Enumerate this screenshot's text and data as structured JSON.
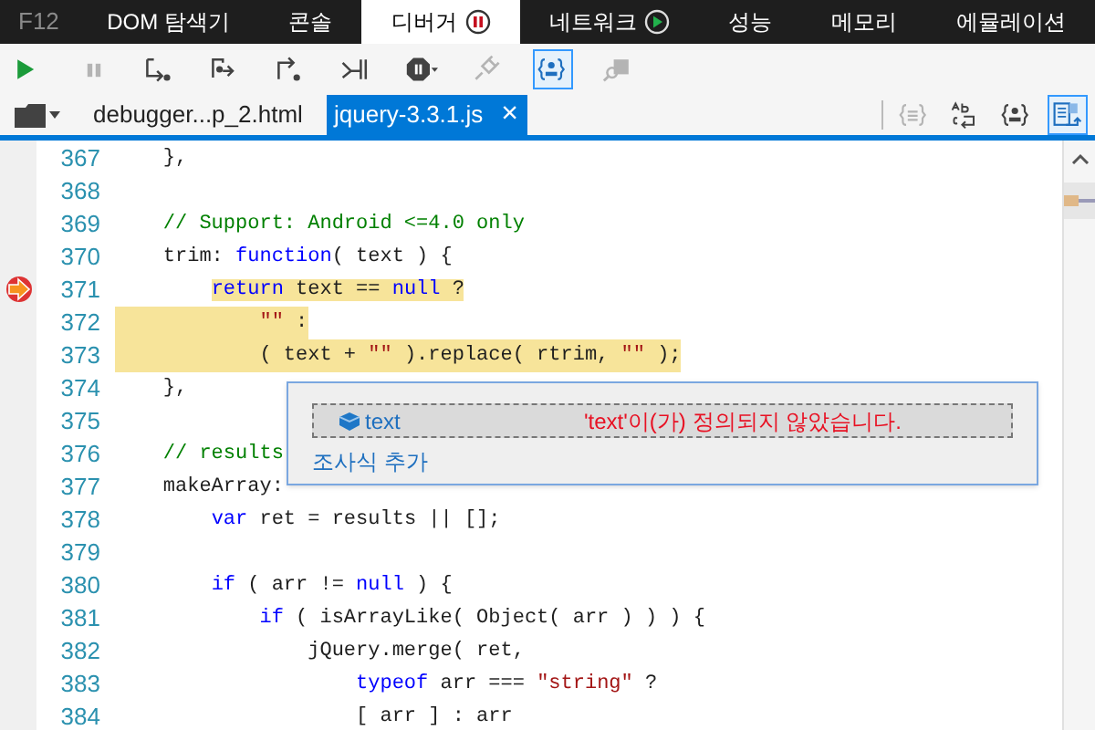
{
  "f12_label": "F12",
  "tabs": [
    {
      "label": "DOM 탐색기",
      "selected": false
    },
    {
      "label": "콘솔",
      "selected": false
    },
    {
      "label": "디버거",
      "selected": true,
      "kind": "paused"
    },
    {
      "label": "네트워크",
      "selected": false,
      "kind": "recording"
    },
    {
      "label": "성능",
      "selected": false
    },
    {
      "label": "메모리",
      "selected": false
    },
    {
      "label": "에뮬레이션",
      "selected": false
    }
  ],
  "toolbar": [
    {
      "kind": "continue",
      "disabled": false,
      "selected": false
    },
    {
      "kind": "pause",
      "disabled": true,
      "selected": false
    },
    {
      "kind": "step-into",
      "disabled": false,
      "selected": false
    },
    {
      "kind": "step-over",
      "disabled": false,
      "selected": false
    },
    {
      "kind": "step-out",
      "disabled": false,
      "selected": false
    },
    {
      "kind": "break-new-worker",
      "disabled": false,
      "selected": false
    },
    {
      "kind": "exception",
      "disabled": false,
      "selected": false
    },
    {
      "kind": "disconnect",
      "disabled": true,
      "selected": false
    },
    {
      "kind": "just-my-code",
      "disabled": false,
      "selected": true
    },
    {
      "kind": "find-source",
      "disabled": true,
      "selected": false
    }
  ],
  "file_tabs": [
    {
      "label": "debugger...p_2.html",
      "selected": false
    },
    {
      "label": "jquery-3.3.1.js",
      "selected": true,
      "close": "×"
    }
  ],
  "editor_tools": [
    {
      "kind": "pretty-print",
      "disabled": true,
      "selected": false
    },
    {
      "kind": "word-wrap",
      "disabled": false,
      "selected": false
    },
    {
      "kind": "just-my-code",
      "disabled": false,
      "selected": false
    },
    {
      "kind": "source-map",
      "disabled": false,
      "selected": true
    }
  ],
  "code_lines": [
    {
      "number": "367",
      "tokens": [
        {
          "kind": "p",
          "text": "    },"
        }
      ]
    },
    {
      "number": "368"
    },
    {
      "number": "369",
      "tokens": [
        {
          "kind": "c",
          "text": "    // Support: Android <=4.0 only"
        }
      ]
    },
    {
      "number": "370",
      "tokens": [
        {
          "kind": "p",
          "text": "    trim: "
        },
        {
          "kind": "k",
          "text": "function"
        },
        {
          "kind": "p",
          "text": "( text ) {"
        }
      ]
    },
    {
      "number": "371",
      "current": true,
      "highlighted": true,
      "tokens": [
        {
          "kind": "k",
          "text": "        return"
        },
        {
          "kind": "p",
          "text": " text == "
        },
        {
          "kind": "k",
          "text": "null"
        },
        {
          "kind": "p",
          "text": " ?"
        }
      ]
    },
    {
      "number": "372",
      "highlighted": true,
      "tokens": [
        {
          "kind": "s",
          "text": "            \"\""
        },
        {
          "kind": "p",
          "text": " :"
        }
      ]
    },
    {
      "number": "373",
      "highlighted": true,
      "tokens": [
        {
          "kind": "p",
          "text": "            ( text + "
        },
        {
          "kind": "s",
          "text": "\"\""
        },
        {
          "kind": "p",
          "text": " ).replace( rtrim, "
        },
        {
          "kind": "s",
          "text": "\"\""
        },
        {
          "kind": "p",
          "text": " );"
        }
      ]
    },
    {
      "number": "374",
      "tokens": [
        {
          "kind": "p",
          "text": "    },"
        }
      ]
    },
    {
      "number": "375"
    },
    {
      "number": "376",
      "tokens": [
        {
          "kind": "c",
          "text": "    // results"
        }
      ]
    },
    {
      "number": "377",
      "tokens": [
        {
          "kind": "p",
          "text": "    makeArray:"
        }
      ]
    },
    {
      "number": "378",
      "tokens": [
        {
          "kind": "k",
          "text": "        var"
        },
        {
          "kind": "p",
          "text": " ret = results || [];"
        }
      ]
    },
    {
      "number": "379"
    },
    {
      "number": "380",
      "tokens": [
        {
          "kind": "k",
          "text": "        if"
        },
        {
          "kind": "p",
          "text": " ( arr != "
        },
        {
          "kind": "k",
          "text": "null"
        },
        {
          "kind": "p",
          "text": " ) {"
        }
      ]
    },
    {
      "number": "381",
      "tokens": [
        {
          "kind": "k",
          "text": "            if"
        },
        {
          "kind": "p",
          "text": " ( isArrayLike( Object( arr ) ) ) {"
        }
      ]
    },
    {
      "number": "382",
      "tokens": [
        {
          "kind": "p",
          "text": "                jQuery.merge( ret,"
        }
      ]
    },
    {
      "number": "383",
      "tokens": [
        {
          "kind": "k",
          "text": "                    typeof"
        },
        {
          "kind": "p",
          "text": " arr === "
        },
        {
          "kind": "s",
          "text": "\"string\""
        },
        {
          "kind": "p",
          "text": " ?"
        }
      ]
    },
    {
      "number": "384",
      "tokens": [
        {
          "kind": "p",
          "text": "                    [ arr ] : arr"
        }
      ]
    }
  ],
  "datatip": {
    "name": "text",
    "message": "'text'이(가) 정의되지 않았습니다.",
    "add_watch": "조사식 추가"
  }
}
